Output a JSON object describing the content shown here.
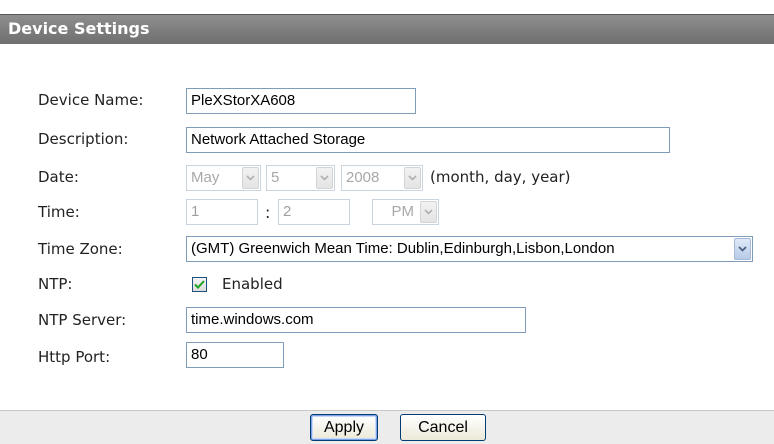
{
  "header": {
    "title": "Device Settings"
  },
  "form": {
    "device_name": {
      "label": "Device Name:",
      "value": "PleXStorXA608"
    },
    "description": {
      "label": "Description:",
      "value": "Network Attached Storage"
    },
    "date": {
      "label": "Date:",
      "month": "May",
      "day": "5",
      "year": "2008",
      "note": "(month, day, year)",
      "enabled": false
    },
    "time": {
      "label": "Time:",
      "hour": "1",
      "separator": ":",
      "minute": "2",
      "ampm": "PM",
      "enabled": false
    },
    "time_zone": {
      "label": "Time Zone:",
      "value": "(GMT) Greenwich Mean Time: Dublin,Edinburgh,Lisbon,London"
    },
    "ntp": {
      "label": "NTP:",
      "checked": true,
      "checkbox_label": "Enabled"
    },
    "ntp_server": {
      "label": "NTP Server:",
      "value": "time.windows.com"
    },
    "http_port": {
      "label": "Http Port:",
      "value": "80"
    }
  },
  "footer": {
    "apply_label": "Apply",
    "cancel_label": "Cancel"
  },
  "icons": {
    "dropdown": "chevron-down-icon",
    "check": "checkmark-icon"
  },
  "colors": {
    "header_bg": "#7d7d7d",
    "header_text": "#ffffff",
    "input_border": "#7f9db9",
    "disabled_text": "#a0a0a0",
    "footer_bg": "#ececec"
  }
}
